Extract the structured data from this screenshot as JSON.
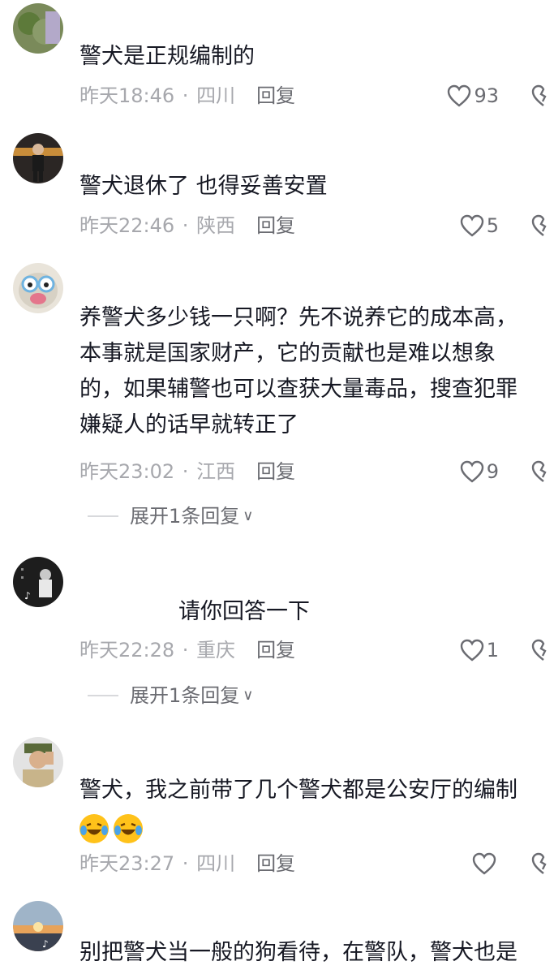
{
  "comments": [
    {
      "text_lines": [
        "警犬是正规编制的"
      ],
      "time": "昨天18:46",
      "location": "四川",
      "reply_label": "回复",
      "likes": "93"
    },
    {
      "text_lines": [
        "警犬退休了 也得妥善安置"
      ],
      "time": "昨天22:46",
      "location": "陕西",
      "reply_label": "回复",
      "likes": "5"
    },
    {
      "text_lines": [
        "养警犬多少钱一只啊？先不说养它的成本高，",
        "本事就是国家财产，它的贡献也是难以想象",
        "的，如果辅警也可以查获大量毒品，搜查犯罪",
        "嫌疑人的话早就转正了"
      ],
      "time": "昨天23:02",
      "location": "江西",
      "reply_label": "回复",
      "likes": "9",
      "expand_label": "展开1条回复"
    },
    {
      "text_lines": [
        "请你回答一下"
      ],
      "time": "昨天22:28",
      "location": "重庆",
      "reply_label": "回复",
      "likes": "1",
      "expand_label": "展开1条回复"
    },
    {
      "text_lines": [
        "警犬，我之前带了几个警犬都是公安厅的编制"
      ],
      "emoji": [
        "laughing-crying-emoji",
        "laughing-crying-emoji"
      ],
      "time": "昨天23:27",
      "location": "四川",
      "reply_label": "回复",
      "likes": ""
    },
    {
      "text_lines": [
        "别把警犬当一般的狗看待，在警队，警犬也是"
      ]
    }
  ],
  "colors": {
    "text": "#161823",
    "meta": "#a7a8ad",
    "action": "#6b6c72",
    "emoji": "#ffc21a"
  }
}
